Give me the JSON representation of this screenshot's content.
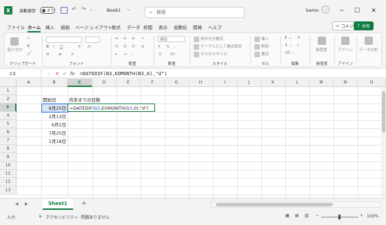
{
  "titlebar": {
    "autosave_label": "自動保存",
    "autosave_state": "オフ",
    "save_icon": "save-icon",
    "filename": "Book1",
    "search_placeholder": "検索",
    "user": "kamo",
    "controls": [
      "─",
      "☐",
      "✕"
    ]
  },
  "tabs": [
    "ファイル",
    "ホーム",
    "挿入",
    "描画",
    "ページ レイアウト",
    "数式",
    "データ",
    "校閲",
    "表示",
    "自動化",
    "開発",
    "ヘルプ"
  ],
  "active_tab": "ホーム",
  "comment_button": "コメント",
  "share_button": "共有",
  "ribbon": {
    "clipboard": {
      "paste": "貼り付け",
      "label": "クリップボード"
    },
    "font": {
      "label": "フォント"
    },
    "alignment": {
      "label": "配置"
    },
    "number": {
      "format": "標準",
      "label": "数値"
    },
    "styles": {
      "conditional": "条件付き書式",
      "table": "テーブルとして書式設定",
      "cell_styles": "セルのスタイル",
      "label": "スタイル"
    },
    "cells": {
      "insert": "挿入",
      "delete": "削除",
      "format": "書式",
      "label": "セル"
    },
    "editing": {
      "label": "編集"
    },
    "sensitivity": {
      "button": "秘密度",
      "label": "秘密度"
    },
    "addins": {
      "button": "アドイン",
      "label": "アドイン"
    },
    "analysis": {
      "button": "データ分析"
    }
  },
  "formula_bar": {
    "name_box": "C3",
    "fx": "fx",
    "formula": "=DATEDIF(B3,EOMONTH(B3,0),\"d\")"
  },
  "grid": {
    "columns": [
      "A",
      "B",
      "C",
      "D",
      "E",
      "F",
      "G",
      "H",
      "I",
      "J",
      "K",
      "L",
      "M",
      "N",
      "O"
    ],
    "rows": [
      "1",
      "2",
      "3",
      "4",
      "5",
      "6",
      "7",
      "8",
      "9",
      "10",
      "11",
      "12",
      "13"
    ],
    "b2": "開始日",
    "c2": "月末までの日数",
    "dates": [
      "8月25日",
      "2月13日",
      "6月1日",
      "7月25日",
      "1月18日"
    ],
    "c3_parts": [
      "=DATEDIF(",
      "B3",
      ",EOMONTH(",
      "B3",
      ",0),\"d\")"
    ]
  },
  "sheets": [
    "Sheet1"
  ],
  "add_sheet": "+",
  "status": {
    "mode": "入力",
    "accessibility": "アクセシビリティ: 問題ありません",
    "zoom": "100%"
  }
}
